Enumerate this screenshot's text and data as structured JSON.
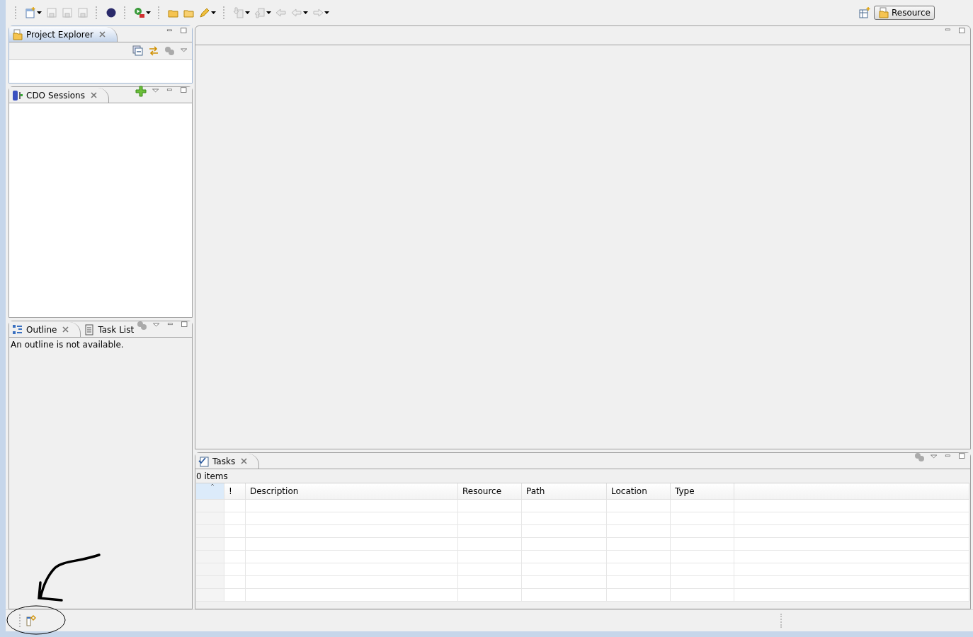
{
  "toolbar": {
    "perspective": {
      "label": "Resource",
      "selected": true
    }
  },
  "project_explorer": {
    "title": "Project Explorer",
    "active": true
  },
  "cdo_sessions": {
    "title": "CDO Sessions",
    "active": false
  },
  "outline": {
    "tabs": [
      {
        "label": "Outline",
        "selected": true
      },
      {
        "label": "Task List",
        "selected": false
      }
    ],
    "message": "An outline is not available."
  },
  "tasks": {
    "title": "Tasks",
    "active": false,
    "count": "0 items",
    "columns": [
      "!",
      "Description",
      "Resource",
      "Path",
      "Location",
      "Type"
    ]
  }
}
